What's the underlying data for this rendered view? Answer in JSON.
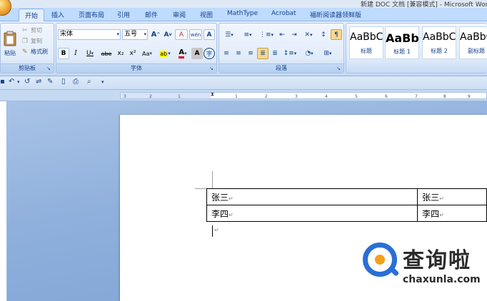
{
  "window": {
    "title": "新建 DOC 文档 [兼容模式] - Microsoft Word"
  },
  "tabs": [
    {
      "label": "开始",
      "active": true
    },
    {
      "label": "插入"
    },
    {
      "label": "页面布局"
    },
    {
      "label": "引用"
    },
    {
      "label": "邮件"
    },
    {
      "label": "审阅"
    },
    {
      "label": "视图"
    },
    {
      "label": "MathType"
    },
    {
      "label": "Acrobat"
    },
    {
      "label": "福昕阅读器领鲜版"
    }
  ],
  "clipboard": {
    "group_label": "剪贴板",
    "paste": "粘贴",
    "cut": "剪切",
    "copy": "复制",
    "format_painter": "格式刷"
  },
  "font": {
    "group_label": "字体",
    "family": "宋体",
    "size": "五号",
    "grow": "A",
    "shrink": "A",
    "clear": "A",
    "phonetic": "wén",
    "border_char": "A",
    "bold": "B",
    "italic": "I",
    "underline": "U",
    "strike": "abe",
    "subscript": "x₂",
    "superscript": "x²",
    "change_case": "Aa",
    "highlight": "ab",
    "font_color": "A",
    "shade_char": "A",
    "enclose_char": "字"
  },
  "paragraph": {
    "group_label": "段落"
  },
  "styles": {
    "items": [
      {
        "sample": "AaBbC",
        "name": "标题"
      },
      {
        "sample": "AaBb",
        "name": "标题 1"
      },
      {
        "sample": "AaBbC",
        "name": "标题 2"
      },
      {
        "sample": "AaBbC",
        "name": "副标题"
      }
    ]
  },
  "ruler": {
    "ticks": [
      "3",
      "2",
      "1",
      "1",
      "2",
      "3",
      "4",
      "5",
      "6",
      "7",
      "8",
      "9",
      "10"
    ]
  },
  "document": {
    "table": [
      [
        "张三",
        "张三"
      ],
      [
        "李四",
        "李四"
      ]
    ],
    "paragraph_mark": "↵"
  },
  "watermark": {
    "brand": "查询啦",
    "domain": "chaxunla.com"
  },
  "colors": {
    "ribbon": "#dbe8f9",
    "tab_bar": "#bfdbff",
    "doc_background": "#8fb0dc",
    "brand_blue": "#2a6fd6",
    "brand_orange": "#f4a11a"
  }
}
